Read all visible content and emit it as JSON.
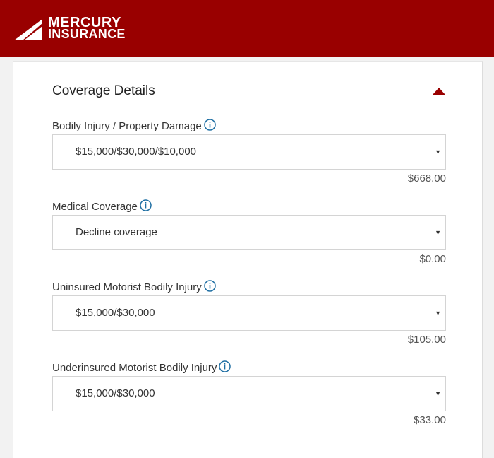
{
  "brand": {
    "line1": "MERCURY",
    "line2": "INSURANCE",
    "header_color": "#990000",
    "logo_icon": "mercury-wing-logo"
  },
  "section": {
    "title": "Coverage Details",
    "toggle_icon": "caret-up-icon",
    "accent_color": "#990000"
  },
  "coverages": [
    {
      "label": "Bodily Injury / Property Damage",
      "selected": "$15,000/$30,000/$10,000",
      "premium": "$668.00"
    },
    {
      "label": "Medical Coverage",
      "selected": "Decline coverage",
      "premium": "$0.00"
    },
    {
      "label": "Uninsured Motorist Bodily Injury",
      "selected": "$15,000/$30,000",
      "premium": "$105.00"
    },
    {
      "label": "Underinsured Motorist Bodily Injury",
      "selected": "$15,000/$30,000",
      "premium": "$33.00"
    }
  ],
  "info_icon_color": "#1f6fa3"
}
